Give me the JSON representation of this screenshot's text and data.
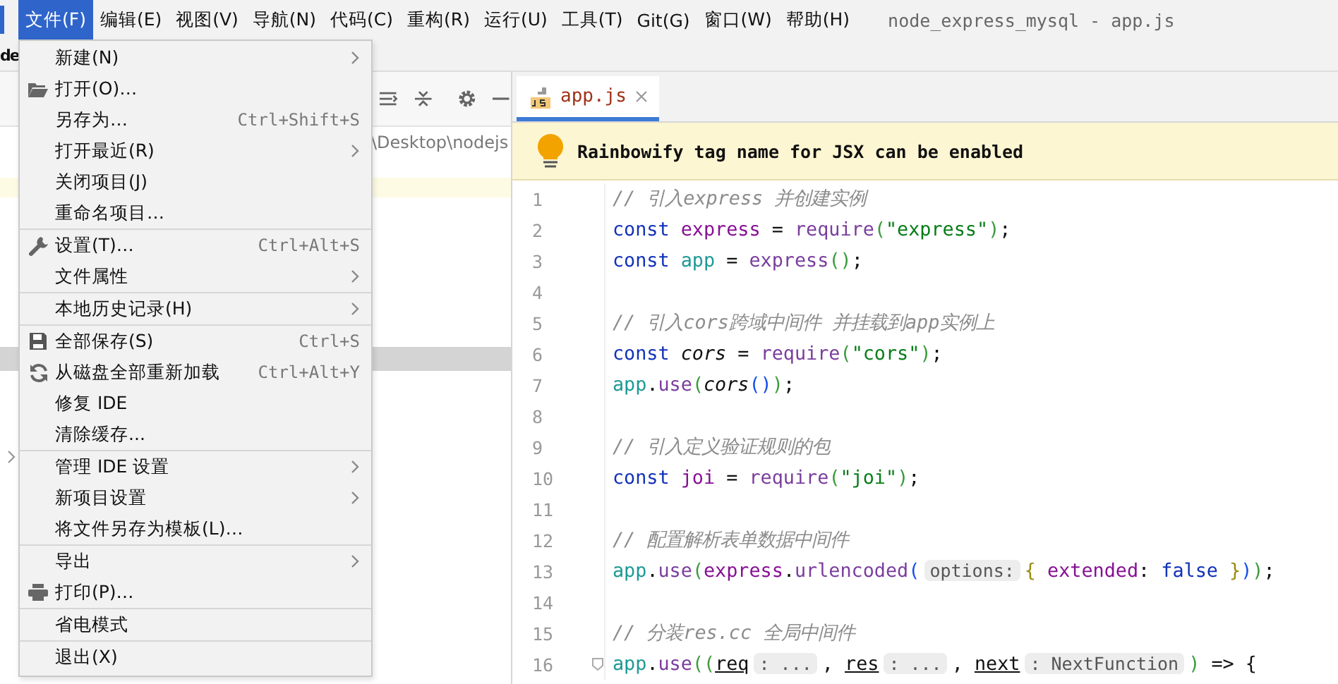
{
  "menubar": {
    "items": [
      {
        "label": "文件(F)",
        "selected": true
      },
      {
        "label": "编辑(E)",
        "selected": false
      },
      {
        "label": "视图(V)",
        "selected": false
      },
      {
        "label": "导航(N)",
        "selected": false
      },
      {
        "label": "代码(C)",
        "selected": false
      },
      {
        "label": "重构(R)",
        "selected": false
      },
      {
        "label": "运行(U)",
        "selected": false
      },
      {
        "label": "工具(T)",
        "selected": false
      },
      {
        "label": "Git(G)",
        "selected": false
      },
      {
        "label": "窗口(W)",
        "selected": false
      },
      {
        "label": "帮助(H)",
        "selected": false
      }
    ],
    "title": "node_express_mysql - app.js"
  },
  "navbar": {
    "crumb": "de"
  },
  "project_panel": {
    "path": "\\Desktop\\nodejs"
  },
  "file_menu": {
    "items": [
      {
        "kind": "item",
        "label": "新建(N)",
        "submenu": true
      },
      {
        "kind": "item",
        "label": "打开(O)…"
      },
      {
        "kind": "item",
        "label": "另存为…",
        "shortcut": "Ctrl+Shift+S"
      },
      {
        "kind": "item",
        "label": "打开最近(R)",
        "submenu": true
      },
      {
        "kind": "item",
        "label": "关闭项目(J)"
      },
      {
        "kind": "item",
        "label": "重命名项目…"
      },
      {
        "kind": "separator"
      },
      {
        "kind": "item",
        "label": "设置(T)…",
        "shortcut": "Ctrl+Alt+S"
      },
      {
        "kind": "item",
        "label": "文件属性",
        "submenu": true
      },
      {
        "kind": "separator"
      },
      {
        "kind": "item",
        "label": "本地历史记录(H)",
        "submenu": true
      },
      {
        "kind": "separator"
      },
      {
        "kind": "item",
        "label": "全部保存(S)",
        "shortcut": "Ctrl+S"
      },
      {
        "kind": "item",
        "label": "从磁盘全部重新加载",
        "shortcut": "Ctrl+Alt+Y"
      },
      {
        "kind": "item",
        "label": "修复 IDE"
      },
      {
        "kind": "item",
        "label": "清除缓存..."
      },
      {
        "kind": "separator"
      },
      {
        "kind": "item",
        "label": "管理 IDE 设置",
        "submenu": true
      },
      {
        "kind": "item",
        "label": "新项目设置",
        "submenu": true
      },
      {
        "kind": "item",
        "label": "将文件另存为模板(L)…"
      },
      {
        "kind": "separator"
      },
      {
        "kind": "item",
        "label": "导出",
        "submenu": true
      },
      {
        "kind": "item",
        "label": "打印(P)…"
      },
      {
        "kind": "separator"
      },
      {
        "kind": "item",
        "label": "省电模式"
      },
      {
        "kind": "separator"
      },
      {
        "kind": "item",
        "label": "退出(X)"
      }
    ]
  },
  "editor": {
    "tab": {
      "label": "app.js",
      "selected": true
    },
    "notice": "Rainbowify tag name for JSX can be enabled",
    "lines": [
      {
        "number": "1",
        "tokens": [
          {
            "text": "// 引入express 并创建实例",
            "kind": "cm"
          }
        ]
      },
      {
        "number": "2",
        "tokens": [
          {
            "text": "const ",
            "kind": "kw"
          },
          {
            "text": "express",
            "kind": "var"
          },
          {
            "text": " = ",
            "kind": "pl"
          },
          {
            "text": "require",
            "kind": "fn"
          },
          {
            "text": "(",
            "kind": "br"
          },
          {
            "text": "\"express\"",
            "kind": "str"
          },
          {
            "text": ")",
            "kind": "br"
          },
          {
            "text": ";",
            "kind": "pl"
          }
        ]
      },
      {
        "number": "3",
        "tokens": [
          {
            "text": "const ",
            "kind": "kw"
          },
          {
            "text": "app",
            "kind": "app"
          },
          {
            "text": " = ",
            "kind": "pl"
          },
          {
            "text": "express",
            "kind": "fn"
          },
          {
            "text": "()",
            "kind": "br"
          },
          {
            "text": ";",
            "kind": "pl"
          }
        ]
      },
      {
        "number": "4"
      },
      {
        "number": "5",
        "tokens": [
          {
            "text": "// 引入cors跨域中间件 并挂载到app实例上",
            "kind": "cm"
          }
        ]
      },
      {
        "number": "6",
        "tokens": [
          {
            "text": "const ",
            "kind": "kw"
          },
          {
            "text": "cors",
            "kind": "it"
          },
          {
            "text": " = ",
            "kind": "pl"
          },
          {
            "text": "require",
            "kind": "fn"
          },
          {
            "text": "(",
            "kind": "br"
          },
          {
            "text": "\"cors\"",
            "kind": "str"
          },
          {
            "text": ")",
            "kind": "br"
          },
          {
            "text": ";",
            "kind": "pl"
          }
        ]
      },
      {
        "number": "7",
        "tokens": [
          {
            "text": "app",
            "kind": "app"
          },
          {
            "text": ".",
            "kind": "pl"
          },
          {
            "text": "use",
            "kind": "fn"
          },
          {
            "text": "(",
            "kind": "br"
          },
          {
            "text": "cors",
            "kind": "it"
          },
          {
            "text": "()",
            "kind": "br2"
          },
          {
            "text": ")",
            "kind": "br"
          },
          {
            "text": ";",
            "kind": "pl"
          }
        ]
      },
      {
        "number": "8"
      },
      {
        "number": "9",
        "tokens": [
          {
            "text": "// 引入定义验证规则的包",
            "kind": "cm"
          }
        ]
      },
      {
        "number": "10",
        "tokens": [
          {
            "text": "const ",
            "kind": "kw"
          },
          {
            "text": "joi",
            "kind": "var"
          },
          {
            "text": " = ",
            "kind": "pl"
          },
          {
            "text": "require",
            "kind": "fn"
          },
          {
            "text": "(",
            "kind": "br"
          },
          {
            "text": "\"joi\"",
            "kind": "str"
          },
          {
            "text": ")",
            "kind": "br"
          },
          {
            "text": ";",
            "kind": "pl"
          }
        ]
      },
      {
        "number": "11"
      },
      {
        "number": "12",
        "tokens": [
          {
            "text": "// 配置解析表单数据中间件",
            "kind": "cm"
          }
        ]
      },
      {
        "number": "13",
        "tokens": [
          {
            "text": "app",
            "kind": "app"
          },
          {
            "text": ".",
            "kind": "pl"
          },
          {
            "text": "use",
            "kind": "fn"
          },
          {
            "text": "(",
            "kind": "br"
          },
          {
            "text": "express",
            "kind": "var"
          },
          {
            "text": ".",
            "kind": "pl"
          },
          {
            "text": "urlencoded",
            "kind": "fn"
          },
          {
            "text": "(",
            "kind": "br2"
          },
          {
            "text": "options:",
            "kind": "hint"
          },
          {
            "text": "{ ",
            "kind": "br3"
          },
          {
            "text": "extended",
            "kind": "var"
          },
          {
            "text": ": ",
            "kind": "pl"
          },
          {
            "text": "false",
            "kind": "kw"
          },
          {
            "text": " }",
            "kind": "br3"
          },
          {
            "text": ")",
            "kind": "br2"
          },
          {
            "text": ")",
            "kind": "br"
          },
          {
            "text": ";",
            "kind": "pl"
          }
        ]
      },
      {
        "number": "14"
      },
      {
        "number": "15",
        "tokens": [
          {
            "text": "// 分装res.cc 全局中间件",
            "kind": "cm"
          }
        ]
      },
      {
        "number": "16",
        "fold": true,
        "tokens": [
          {
            "text": "app",
            "kind": "app"
          },
          {
            "text": ".",
            "kind": "pl"
          },
          {
            "text": "use",
            "kind": "fn"
          },
          {
            "text": "((",
            "kind": "br"
          },
          {
            "text": "req",
            "kind": "ul"
          },
          {
            "text": ": ...",
            "kind": "hint"
          },
          {
            "text": ", ",
            "kind": "pl"
          },
          {
            "text": "res",
            "kind": "ul"
          },
          {
            "text": ": ...",
            "kind": "hint"
          },
          {
            "text": ", ",
            "kind": "pl"
          },
          {
            "text": "next",
            "kind": "ul"
          },
          {
            "text": ": NextFunction",
            "kind": "hint"
          },
          {
            "text": ")",
            "kind": "br"
          },
          {
            "text": " => {",
            "kind": "pl"
          }
        ]
      }
    ]
  }
}
